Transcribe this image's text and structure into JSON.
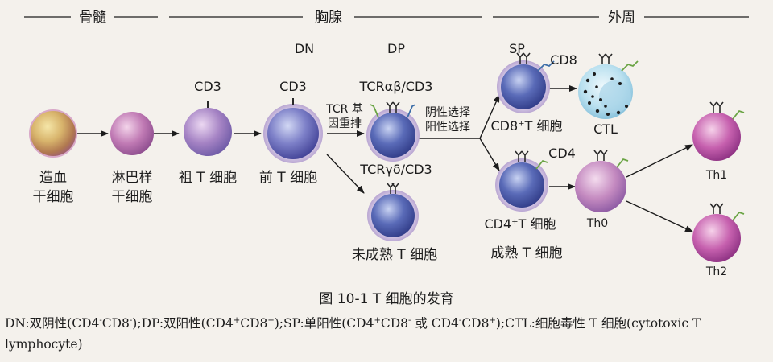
{
  "regions": {
    "bone_marrow": "骨髓",
    "thymus": "胸腺",
    "periphery": "外周"
  },
  "stage_labels": {
    "dn": "DN",
    "dp": "DP",
    "sp": "SP"
  },
  "cells": {
    "hsc": [
      "造血",
      "干细胞"
    ],
    "lymphoid": [
      "淋巴样",
      "干细胞"
    ],
    "pro_t": "祖 T 细胞",
    "pre_t": "前 T 细胞",
    "immature_t": "未成熟 T 细胞",
    "mature_t": "成熟 T 细胞",
    "cd8_t": "CD8⁺T 细胞",
    "cd4_t": "CD4⁺T 细胞",
    "ctl": "CTL",
    "th0": "Th0",
    "th1": "Th1",
    "th2": "Th2"
  },
  "markers": {
    "cd3_a": "CD3",
    "cd3_b": "CD3",
    "tcr_ab": "TCRαβ/CD3",
    "tcr_gd": "TCRγδ/CD3",
    "cd8": "CD8",
    "cd4": "CD4"
  },
  "process_labels": {
    "tcr_rearrange": [
      "TCR 基",
      "因重排"
    ],
    "selection": [
      "阴性选择",
      "阳性选择"
    ]
  },
  "caption": "图 10-1   T 细胞的发育",
  "legend": {
    "dn": "DN:双阴性(CD4",
    "dn_sup1": "-",
    "dn_mid": "CD8",
    "dn_sup2": "-",
    "dn_end": ");",
    "dp": "DP:双阳性(CD4",
    "dp_sup1": "+",
    "dp_mid": "CD8",
    "dp_sup2": "+",
    "dp_end": ");",
    "sp": "SP:单阳性(CD4",
    "sp_sup1": "+",
    "sp_mid1": "CD8",
    "sp_sup2": "-",
    "sp_or": " 或 CD4",
    "sp_sup3": "-",
    "sp_mid2": "CD8",
    "sp_sup4": "+",
    "sp_end": ");",
    "ctl": "CTL:细胞毒性 T 细胞(cytotoxic T lymphocyte)"
  },
  "colors": {
    "hsc": "#b98c54",
    "lymphoid": "#b56ba6",
    "pro_t": "#9d72b8",
    "pre_t": "#6f6ab8",
    "dp": "#4a59a6",
    "ctl": "#bfe0ee",
    "th": "#c060a8",
    "receptor_green": "#6aa444",
    "receptor_blue": "#3d6ea8"
  }
}
